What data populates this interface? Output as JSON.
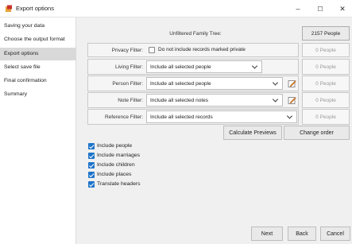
{
  "window": {
    "title": "Export options",
    "minimize": "–",
    "maximize": "☐",
    "close": "✕"
  },
  "sidebar": {
    "items": [
      {
        "label": "Saving your data"
      },
      {
        "label": "Choose the output format"
      },
      {
        "label": "Export options",
        "active": true
      },
      {
        "label": "Select save file"
      },
      {
        "label": "Final confirmation"
      },
      {
        "label": "Summary"
      }
    ]
  },
  "header": {
    "tree_label": "Unfiltered Family Tree:",
    "tree_count": "2157 People"
  },
  "filters": {
    "privacy": {
      "label": "Privacy Filter:",
      "checkbox_label": "Do not include records marked private",
      "checked": false,
      "count": "0 People"
    },
    "living": {
      "label": "Living Filter:",
      "value": "Include all selected people",
      "count": "0 People"
    },
    "person": {
      "label": "Person Filter:",
      "value": "Include all selected people",
      "count": "0 People"
    },
    "note": {
      "label": "Note Filter:",
      "value": "Include all selected notes",
      "count": "0 People"
    },
    "reference": {
      "label": "Reference Filter:",
      "value": "Include all selected records",
      "count": "0 People"
    }
  },
  "actions": {
    "calculate": "Calculate Previews",
    "change_order": "Change order"
  },
  "options": [
    {
      "label": "Include people",
      "checked": true
    },
    {
      "label": "Include marriages",
      "checked": true
    },
    {
      "label": "Include children",
      "checked": true
    },
    {
      "label": "Include places",
      "checked": true
    },
    {
      "label": "Translate headers",
      "checked": true
    }
  ],
  "footer": {
    "next": "Next",
    "back": "Back",
    "cancel": "Cancel"
  },
  "colors": {
    "accent": "#1e74c9",
    "active_item": "#d9d9d9"
  }
}
